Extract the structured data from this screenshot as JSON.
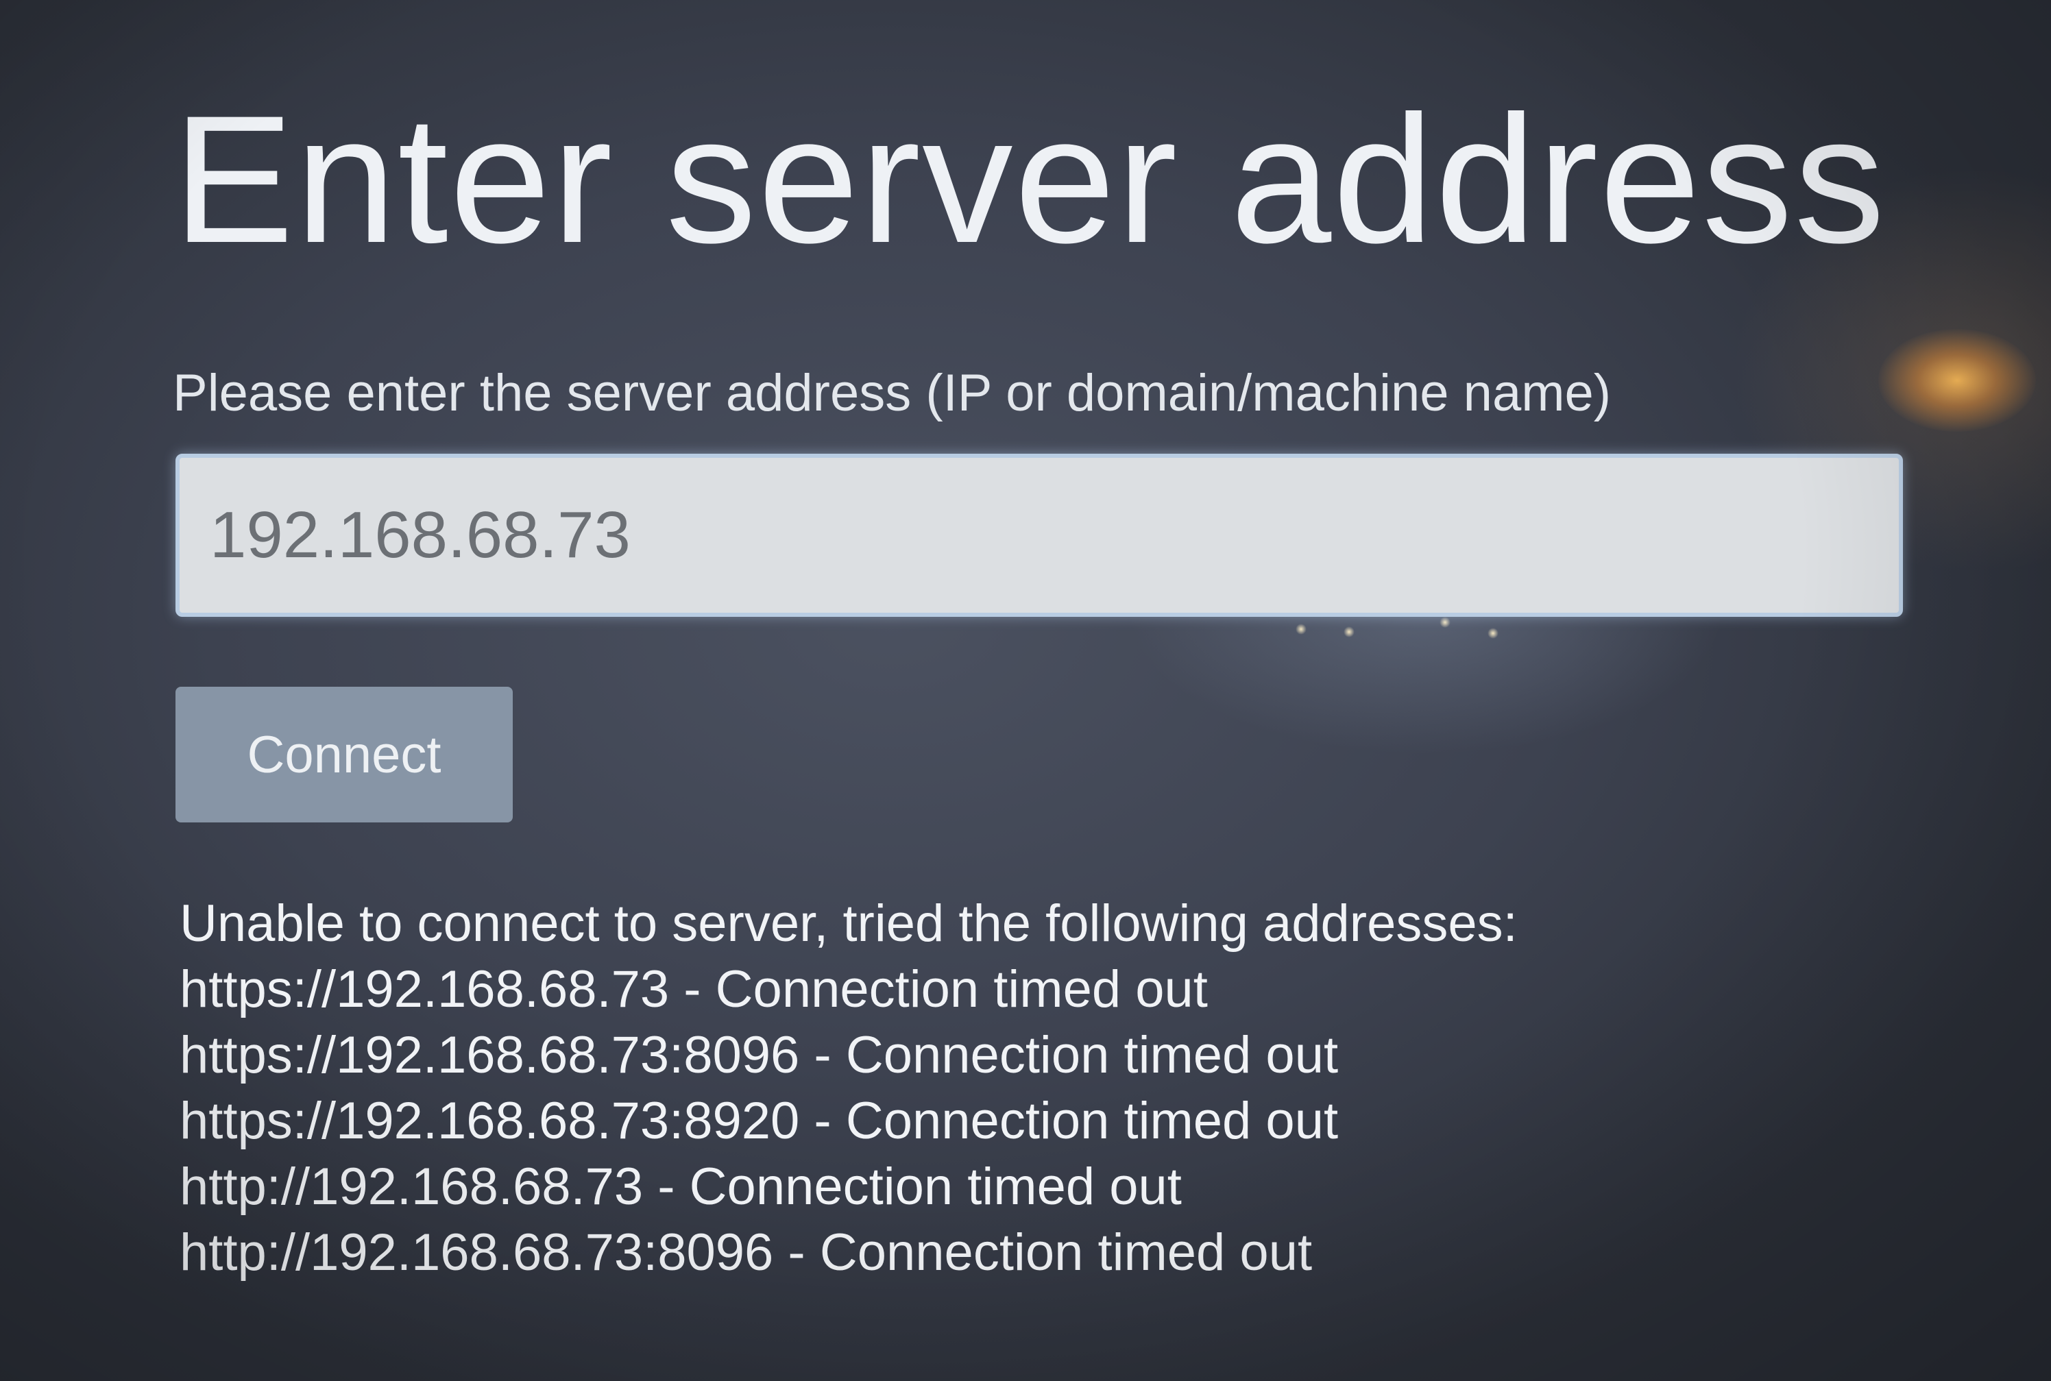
{
  "screen": {
    "title": "Enter server address",
    "prompt": "Please enter the server address (IP or domain/machine name)"
  },
  "address_input": {
    "value": "192.168.68.73"
  },
  "connect_button": {
    "label": "Connect"
  },
  "error": {
    "heading": "Unable to connect to server, tried the following addresses:",
    "attempts": [
      "https://192.168.68.73 - Connection timed out",
      "https://192.168.68.73:8096 - Connection timed out",
      "https://192.168.68.73:8920 - Connection timed out",
      "http://192.168.68.73 - Connection timed out",
      "http://192.168.68.73:8096 - Connection timed out"
    ]
  }
}
